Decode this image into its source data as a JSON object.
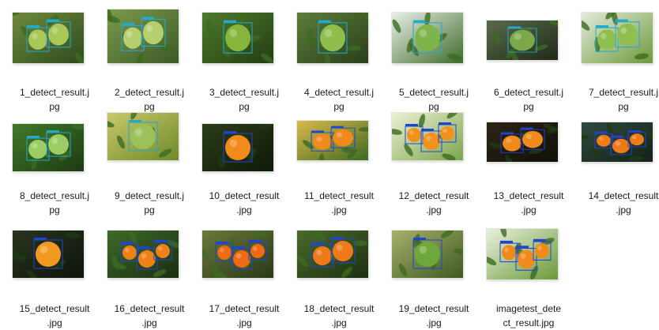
{
  "files": [
    {
      "name": "1_detect_result.jpg",
      "line1": "1_detect_result.j",
      "line2": "pg",
      "bg": [
        "#6f8a3c",
        "#2f4a1c"
      ],
      "fruit": "#a9c857",
      "dark": false,
      "fruits": 2,
      "boxColor": "#22aacc"
    },
    {
      "name": "2_detect_result.jpg",
      "line1": "2_detect_result.j",
      "line2": "pg",
      "bg": [
        "#7d9a4d",
        "#3c5a25"
      ],
      "fruit": "#b6cf6e",
      "dark": false,
      "fruits": 2,
      "boxColor": "#22aacc"
    },
    {
      "name": "3_detect_result.jpg",
      "line1": "3_detect_result.j",
      "line2": "pg",
      "bg": [
        "#4f7a2c",
        "#223d12"
      ],
      "fruit": "#86b53c",
      "dark": false,
      "fruits": 1,
      "boxColor": "#22aacc"
    },
    {
      "name": "4_detect_result.jpg",
      "line1": "4_detect_result.j",
      "line2": "pg",
      "bg": [
        "#5b7d3a",
        "#2a3f1a"
      ],
      "fruit": "#8ebf4c",
      "dark": false,
      "fruits": 1,
      "boxColor": "#22aacc"
    },
    {
      "name": "5_detect_result.jpg",
      "line1": "5_detect_result.j",
      "line2": "pg",
      "bg": [
        "#e9efe6",
        "#3f6b2a"
      ],
      "fruit": "#7db54a",
      "dark": false,
      "fruits": 1,
      "boxColor": "#22aacc"
    },
    {
      "name": "6_detect_result.jpg",
      "line1": "6_detect_result.j",
      "line2": "pg",
      "bg": [
        "#5a6b4a",
        "#1f2a18"
      ],
      "fruit": "#7aa84a",
      "dark": false,
      "fruits": 1,
      "boxColor": "#22aacc"
    },
    {
      "name": "7_detect_result.jpg",
      "line1": "7_detect_result.j",
      "line2": "pg",
      "bg": [
        "#e3ead8",
        "#6f9a3d"
      ],
      "fruit": "#8fbf4e",
      "dark": false,
      "fruits": 2,
      "boxColor": "#22aacc"
    },
    {
      "name": "8_detect_result.jpg",
      "line1": "8_detect_result.j",
      "line2": "pg",
      "bg": [
        "#3f7a2a",
        "#1d3a12"
      ],
      "fruit": "#9ccc63",
      "dark": false,
      "fruits": 2,
      "boxColor": "#22aacc"
    },
    {
      "name": "9_detect_result.jpg",
      "line1": "9_detect_result.j",
      "line2": "pg",
      "bg": [
        "#c8c86a",
        "#6f8a2a"
      ],
      "fruit": "#9cc05a",
      "dark": false,
      "fruits": 1,
      "boxColor": "#22aacc"
    },
    {
      "name": "10_detect_result.jpg",
      "line1": "10_detect_result",
      "line2": ".jpg",
      "bg": [
        "#2b3d18",
        "#0f1a08"
      ],
      "fruit": "#f28a1c",
      "dark": true,
      "fruits": 1,
      "boxColor": "#2244cc"
    },
    {
      "name": "11_detect_result.jpg",
      "line1": "11_detect_result",
      "line2": ".jpg",
      "bg": [
        "#d9b94a",
        "#3f6a22"
      ],
      "fruit": "#f08a1a",
      "dark": false,
      "fruits": 2,
      "boxColor": "#2244cc"
    },
    {
      "name": "12_detect_result.jpg",
      "line1": "12_detect_result",
      "line2": ".jpg",
      "bg": [
        "#eef0d8",
        "#7aa64a"
      ],
      "fruit": "#f0901e",
      "dark": false,
      "fruits": 3,
      "boxColor": "#2244cc"
    },
    {
      "name": "13_detect_result.jpg",
      "line1": "13_detect_result",
      "line2": ".jpg",
      "bg": [
        "#2d2416",
        "#101008"
      ],
      "fruit": "#f08a1a",
      "dark": true,
      "fruits": 2,
      "boxColor": "#2244cc"
    },
    {
      "name": "14_detect_result.jpg",
      "line1": "14_detect_result",
      "line2": ".jpg",
      "bg": [
        "#2f4a3f",
        "#142218"
      ],
      "fruit": "#ef7a1a",
      "dark": true,
      "fruits": 3,
      "boxColor": "#2244cc"
    },
    {
      "name": "15_detect_result.jpg",
      "line1": "15_detect_result",
      "line2": ".jpg",
      "bg": [
        "#2a3520",
        "#0d140a"
      ],
      "fruit": "#f29a20",
      "dark": true,
      "fruits": 1,
      "boxColor": "#2244cc"
    },
    {
      "name": "16_detect_result.jpg",
      "line1": "16_detect_result",
      "line2": ".jpg",
      "bg": [
        "#3f6a2a",
        "#1a2e10"
      ],
      "fruit": "#ee8218",
      "dark": false,
      "fruits": 3,
      "boxColor": "#2244cc"
    },
    {
      "name": "17_detect_result.jpg",
      "line1": "17_detect_result",
      "line2": ".jpg",
      "bg": [
        "#6a7a3a",
        "#2a3818"
      ],
      "fruit": "#ef6a14",
      "dark": false,
      "fruits": 3,
      "boxColor": "#2244cc"
    },
    {
      "name": "18_detect_result.jpg",
      "line1": "18_detect_result",
      "line2": ".jpg",
      "bg": [
        "#4a6a2a",
        "#1d3010"
      ],
      "fruit": "#ee7a1a",
      "dark": false,
      "fruits": 2,
      "boxColor": "#2244cc"
    },
    {
      "name": "19_detect_result.jpg",
      "line1": "19_detect_result",
      "line2": ".jpg",
      "bg": [
        "#a8b06a",
        "#3d5a22"
      ],
      "fruit": "#6fa83a",
      "dark": false,
      "fruits": 1,
      "boxColor": "#2244cc"
    },
    {
      "name": "imagetest_detect_result.jpg",
      "line1": "imagetest_dete",
      "line2": "ct_result.jpg",
      "bg": [
        "#eaf0dc",
        "#6a9a3a"
      ],
      "fruit": "#f08a1a",
      "dark": false,
      "fruits": 3,
      "boxColor": "#2244cc"
    }
  ]
}
